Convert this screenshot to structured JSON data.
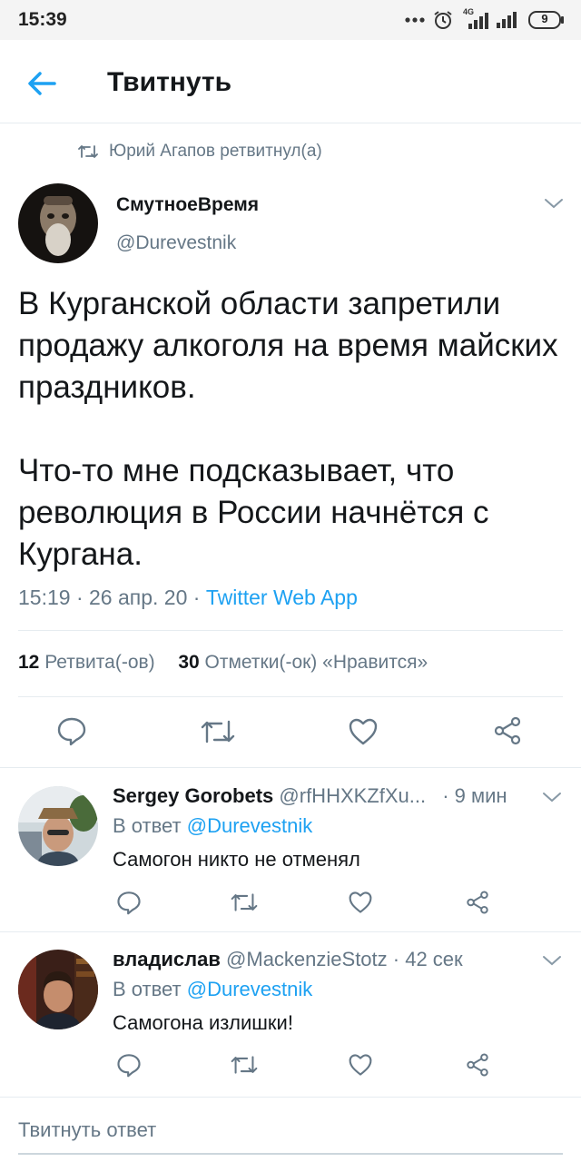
{
  "status_bar": {
    "time": "15:39",
    "network": "4G",
    "battery_level": "9"
  },
  "header": {
    "title": "Твитнуть"
  },
  "retweet": {
    "text": "Юрий Агапов ретвитнул(а)"
  },
  "tweet": {
    "author_name": "СмутноеВремя",
    "author_handle": "@Durevestnik",
    "text": "В Курганской области запретили продажу алкоголя на время майских праздников.\n\nЧто-то мне подсказывает, что революция в России начнётся с Кургана.",
    "time": "15:19",
    "date": "26 апр. 20",
    "app": "Twitter Web App",
    "retweets_count": "12",
    "retweets_label": "Ретвита(-ов)",
    "likes_count": "30",
    "likes_label": "Отметки(-ок) «Нравится»"
  },
  "replies": [
    {
      "name": "Sergey Gorobets",
      "handle": "@rfHHXKZfXu...",
      "time": "· 9 мин",
      "reply_to_label": "В ответ",
      "reply_to_handle": "@Durevestnik",
      "text": "Самогон никто не отменял"
    },
    {
      "name": "владислав",
      "handle": "@MackenzieStotz",
      "time": "· 42 сек",
      "reply_to_label": "В ответ",
      "reply_to_handle": "@Durevestnik",
      "text": "Самогона излишки!"
    }
  ],
  "compose": {
    "placeholder": "Твитнуть ответ"
  },
  "icons": {
    "back": "arrow-left-icon",
    "retweet": "retweet-icon",
    "reply": "reply-icon",
    "like": "heart-icon",
    "share": "share-icon",
    "caret": "chevron-down-icon"
  },
  "colors": {
    "accent": "#1da1f2",
    "secondary_text": "#657786",
    "primary_text": "#14171a",
    "divider": "#e6ecf0"
  }
}
